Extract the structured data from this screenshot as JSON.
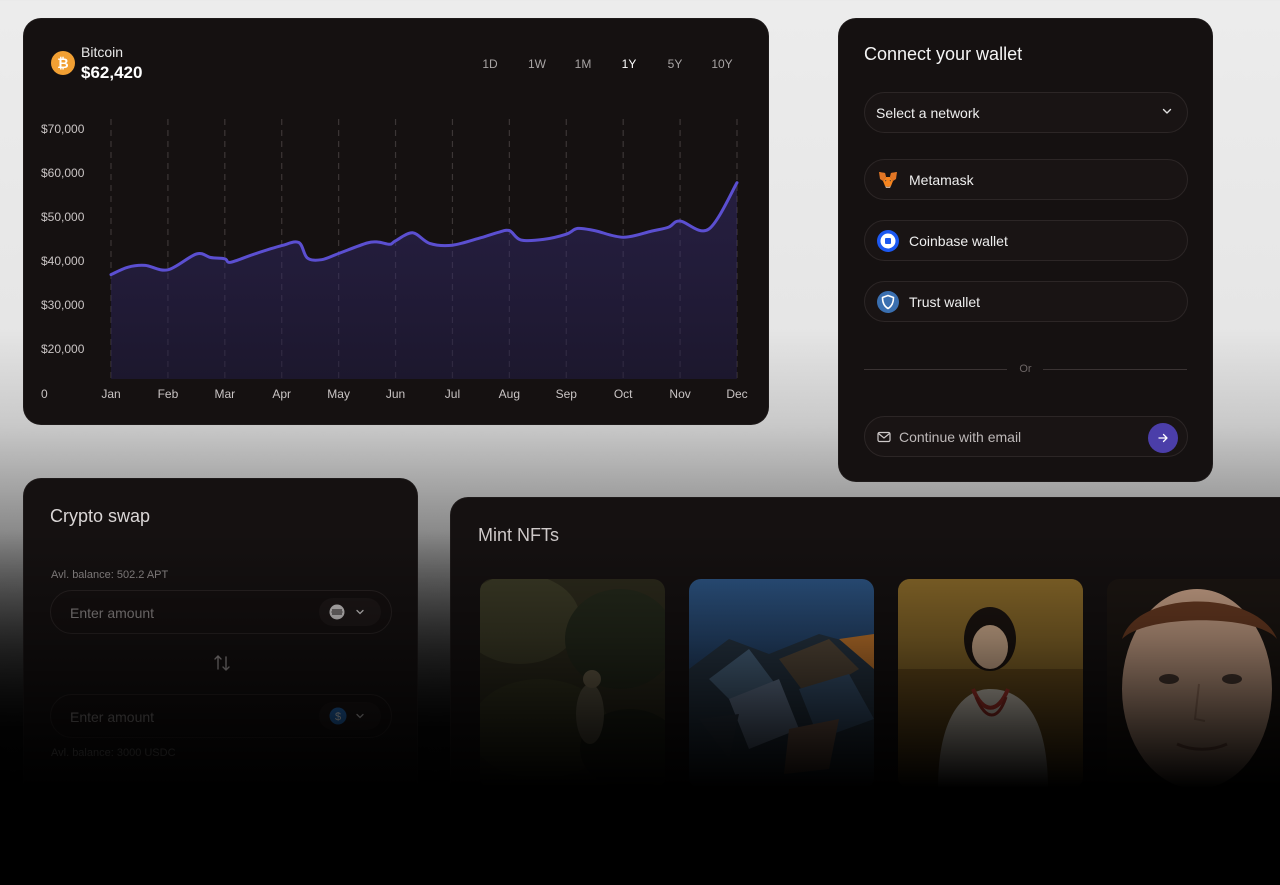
{
  "chart_card": {
    "coin_name": "Bitcoin",
    "coin_price": "$62,420",
    "ranges": [
      "1D",
      "1W",
      "1M",
      "1Y",
      "5Y",
      "10Y"
    ],
    "active_range": "1Y"
  },
  "chart_data": {
    "type": "area",
    "title": "",
    "xlabel": "",
    "ylabel": "",
    "categories": [
      "Jan",
      "Feb",
      "Mar",
      "Apr",
      "May",
      "Jun",
      "Jul",
      "Aug",
      "Sep",
      "Oct",
      "Nov",
      "Dec"
    ],
    "y_ticks": [
      "$70,000",
      "$60,000",
      "$50,000",
      "$40,000",
      "$30,000",
      "$20,000",
      "0"
    ],
    "ylim": [
      10000,
      70000
    ],
    "grid": "vertical dashed",
    "series": [
      {
        "color": "#5b4fd1",
        "x": [
          0,
          0.3,
          0.6,
          1.0,
          1.5,
          1.75,
          2.0,
          2.1,
          2.5,
          3.0,
          3.3,
          3.45,
          3.7,
          4.0,
          4.5,
          4.7,
          4.9,
          5.0,
          5.3,
          5.6,
          6.0,
          6.5,
          6.8,
          7.0,
          7.2,
          7.6,
          8.0,
          8.2,
          8.5,
          9.0,
          9.5,
          9.8,
          10.0,
          10.5,
          11.0
        ],
        "y": [
          36900,
          38600,
          39000,
          38000,
          41600,
          40800,
          40500,
          39700,
          41500,
          43500,
          44200,
          40700,
          40300,
          41700,
          44100,
          44300,
          43800,
          44600,
          46400,
          44000,
          43600,
          45300,
          46500,
          46900,
          44800,
          44900,
          46100,
          47400,
          46900,
          45400,
          46800,
          47700,
          49100,
          47200,
          57800
        ]
      }
    ]
  },
  "wallet_card": {
    "title": "Connect your wallet",
    "network_placeholder": "Select a network",
    "wallets": [
      {
        "label": "Metamask",
        "icon": "metamask-fox-icon"
      },
      {
        "label": "Coinbase wallet",
        "icon": "coinbase-icon"
      },
      {
        "label": "Trust wallet",
        "icon": "trust-shield-icon"
      }
    ],
    "or_label": "Or",
    "email_placeholder": "Continue with email"
  },
  "swap_card": {
    "title": "Crypto swap",
    "balance_top": "Avl. balance: 502.2 APT",
    "amount_placeholder_top": "Enter amount",
    "amount_placeholder_bottom": "Enter amount",
    "balance_bottom": "Avl. balance: 3000 USDC",
    "token_top_icon": "aptos-icon",
    "token_bottom_icon": "usdc-icon"
  },
  "nft_card": {
    "title": "Mint NFTs",
    "items": [
      "forest-painting",
      "abstract-landscape",
      "woman-portrait",
      "man-portrait"
    ]
  },
  "colors": {
    "card_bg": "#151111",
    "accent": "#5b4fd1",
    "bitcoin": "#f2a033"
  }
}
